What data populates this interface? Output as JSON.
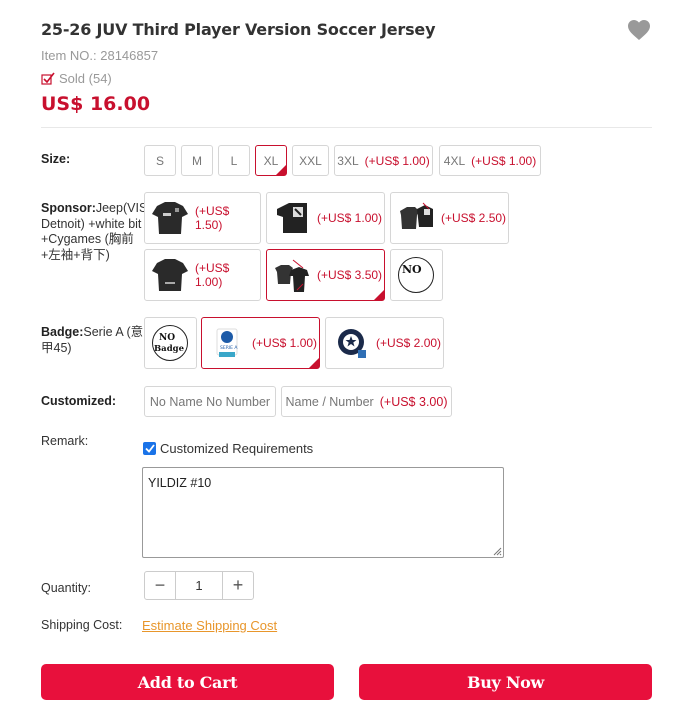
{
  "product": {
    "title": "25-26 JUV Third Player Version Soccer Jersey",
    "item_no": "Item NO.: 28146857",
    "sold": "Sold (54)",
    "price": "US$ 16.00"
  },
  "size": {
    "label": "Size:",
    "options": [
      {
        "name": "S",
        "extra": ""
      },
      {
        "name": "M",
        "extra": ""
      },
      {
        "name": "L",
        "extra": ""
      },
      {
        "name": "XL",
        "extra": "",
        "selected": true
      },
      {
        "name": "XXL",
        "extra": ""
      },
      {
        "name": "3XL",
        "extra": "(+US$ 1.00)"
      },
      {
        "name": "4XL",
        "extra": "(+US$ 1.00)"
      }
    ]
  },
  "sponsor": {
    "label": "Sponsor:",
    "value": "Jeep(VISIT Detnoit) +white bit +Cygames (胸前+左袖+背下)",
    "options": [
      {
        "extra": "(+US$ 1.50)"
      },
      {
        "extra": "(+US$ 1.00)"
      },
      {
        "extra": "(+US$ 2.50)"
      },
      {
        "extra": "(+US$ 1.00)"
      },
      {
        "extra": "(+US$ 3.50)",
        "selected": true
      },
      {
        "image_text": "NO"
      }
    ]
  },
  "badge": {
    "label": "Badge:",
    "value": "Serie A (意甲45)",
    "options": [
      {
        "image_text": "NO Badge"
      },
      {
        "extra": "(+US$ 1.00)",
        "image_text": "SERIE A",
        "selected": true
      },
      {
        "extra": "(+US$ 2.00)"
      }
    ]
  },
  "customized": {
    "label": "Customized:",
    "options": [
      {
        "name": "No Name No Number",
        "extra": ""
      },
      {
        "name": "Name / Number",
        "extra": "(+US$ 3.00)"
      }
    ]
  },
  "remark": {
    "label": "Remark:",
    "checkbox_label": "Customized Requirements",
    "checked": true,
    "text": "YILDIZ #10"
  },
  "quantity": {
    "label": "Quantity:",
    "minus": "−",
    "value": "1",
    "plus": "+"
  },
  "shipping": {
    "label": "Shipping Cost:",
    "link": "Estimate Shipping Cost"
  },
  "actions": {
    "add_to_cart": "Add to Cart",
    "buy_now": "Buy Now"
  },
  "colors": {
    "accent": "#c8102e",
    "button": "#e8103c",
    "link": "#e8962b",
    "checkbox": "#1a73e8"
  },
  "icons": {
    "wishlist": "heart-icon",
    "sold": "check-box-icon"
  }
}
